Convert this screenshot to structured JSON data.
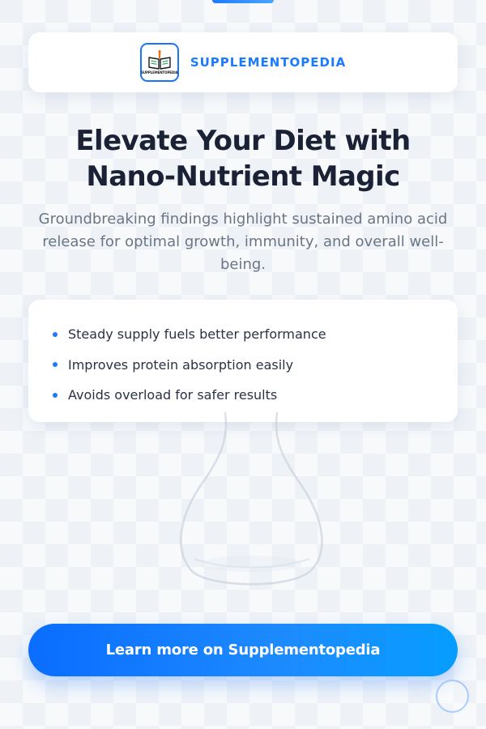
{
  "brand": {
    "name": "SUPPLEMENTOPEDIA",
    "logo_text": "SUPPLEMENTOPEDIA",
    "logo_icon": "open-book-icon",
    "accent_color": "#1a7bff"
  },
  "hero": {
    "title_line_1": "Elevate Your Diet with",
    "title_line_2": "Nano-Nutrient Magic",
    "subtitle": "Groundbreaking findings highlight sustained amino acid release for optimal growth, immunity, and overall well-being."
  },
  "benefits": [
    {
      "text": "Steady supply fuels better performance"
    },
    {
      "text": "Improves protein absorption easily"
    },
    {
      "text": "Avoids overload for safer results"
    }
  ],
  "cta": {
    "label": "Learn more on Supplementopedia"
  },
  "decor": {
    "background_icon": "flask-icon",
    "corner_icon": "circle-ring-icon"
  }
}
